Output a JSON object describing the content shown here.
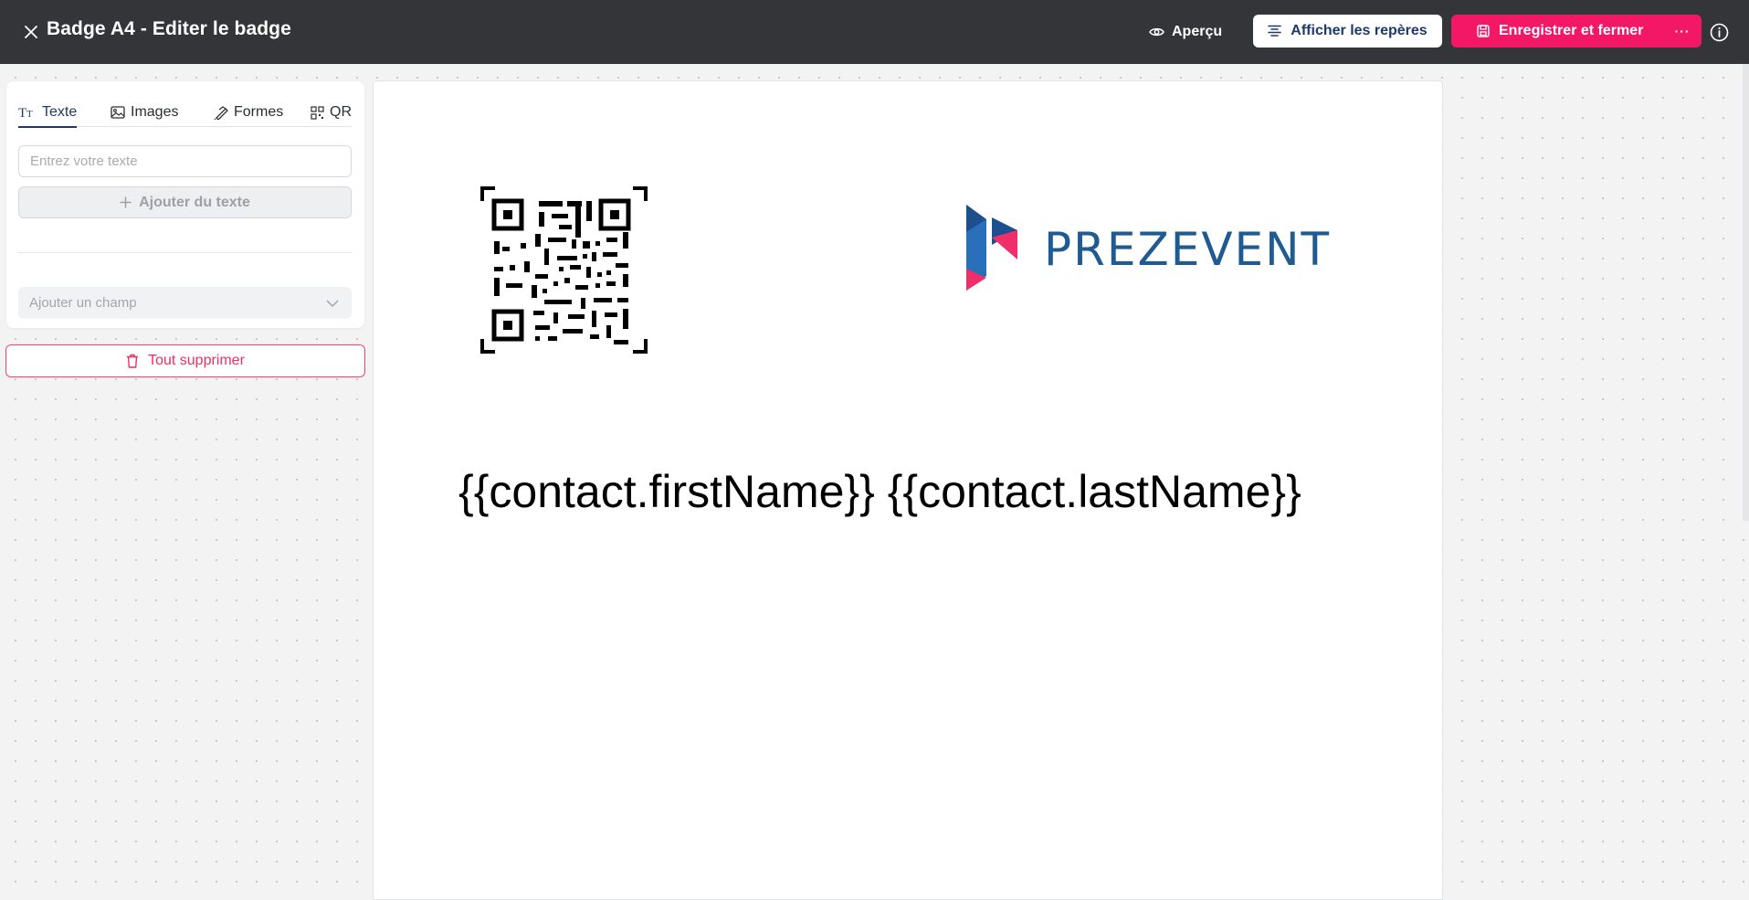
{
  "header": {
    "title": "Badge A4 - Editer le badge",
    "preview_label": "Aperçu",
    "guides_label": "Afficher les repères",
    "save_label": "Enregistrer et fermer",
    "more_label": "···"
  },
  "panel": {
    "tabs": [
      {
        "label": "Texte",
        "icon": "text-icon"
      },
      {
        "label": "Images",
        "icon": "image-icon"
      },
      {
        "label": "Formes",
        "icon": "shapes-icon"
      },
      {
        "label": "QR",
        "icon": "qr-icon"
      }
    ],
    "text_input_placeholder": "Entrez votre texte",
    "add_text_label": "Ajouter du texte",
    "field_select_placeholder": "Ajouter un champ",
    "delete_all_label": "Tout supprimer"
  },
  "canvas": {
    "logo_text": "PREZEVENT",
    "name_placeholder": "{{contact.firstName}} {{contact.lastName}}"
  },
  "colors": {
    "topbar": "#333538",
    "accent_pink": "#f21866",
    "navy": "#1e3a6b",
    "logo_blue": "#1f5a93"
  }
}
